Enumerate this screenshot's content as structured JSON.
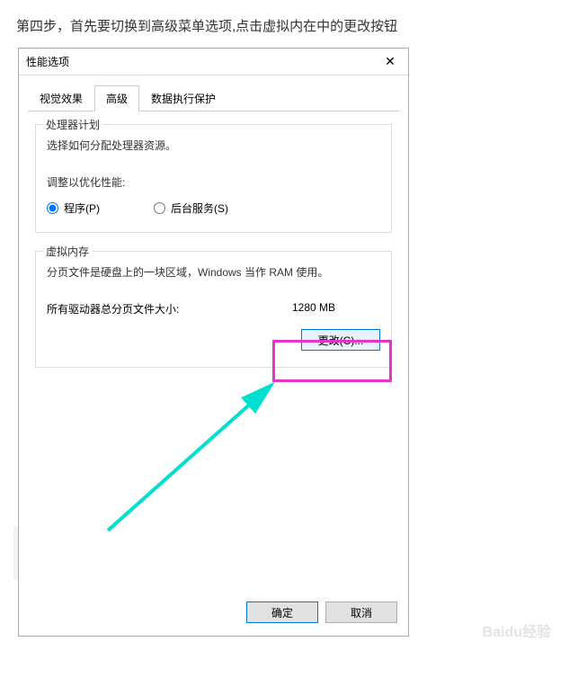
{
  "instruction": "第四步，首先要切换到高级菜单选项,点击虚拟内在中的更改按钮",
  "dialog": {
    "title": "性能选项",
    "tabs": [
      {
        "label": "视觉效果"
      },
      {
        "label": "高级"
      },
      {
        "label": "数据执行保护"
      }
    ],
    "processor": {
      "legend": "处理器计划",
      "desc": "选择如何分配处理器资源。",
      "adjust_label": "调整以优化性能:",
      "options": {
        "program": "程序(P)",
        "background": "后台服务(S)"
      }
    },
    "virtual_memory": {
      "legend": "虚拟内存",
      "desc": "分页文件是硬盘上的一块区域，Windows 当作 RAM 使用。",
      "total_label": "所有驱动器总分页文件大小:",
      "total_value": "1280 MB",
      "change_btn": "更改(C)..."
    },
    "footer": {
      "ok": "确定",
      "cancel": "取消"
    }
  },
  "watermark": "Baidu经验"
}
